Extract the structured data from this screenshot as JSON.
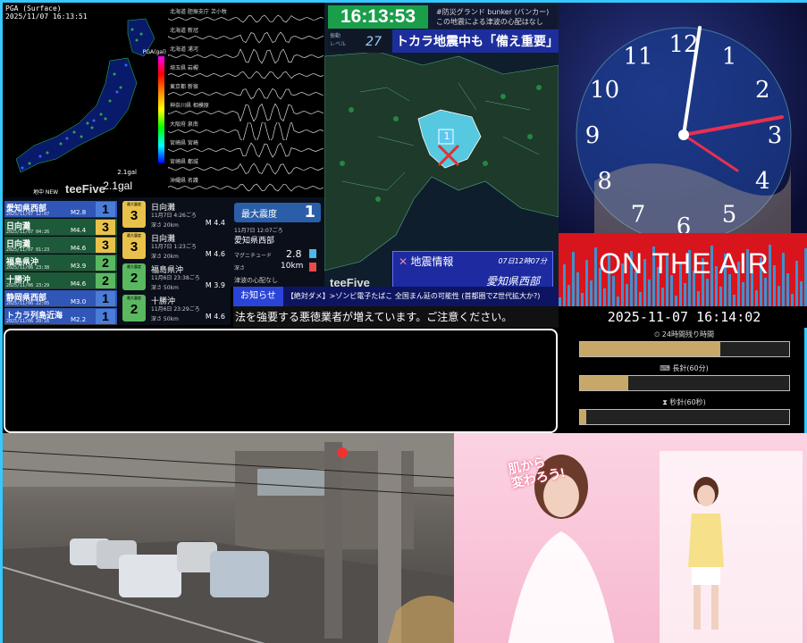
{
  "pga_panel": {
    "header_line1": "PGA (Surface)",
    "header_line2": "2025/11/07 16:13:51",
    "legend_title": "PGA(gal)",
    "gal_value": "2.1gal",
    "gal_small": "2.1gal",
    "footer_left": "地中 NEW",
    "logo": "teeFive"
  },
  "waveforms": {
    "stations": [
      "北海道 胆振支庁 苫小牧",
      "北海道 新冠",
      "北海道 浦河",
      "埼玉県 岩槻",
      "東京都 新宿",
      "神奈川県 相模原",
      "大阪府 泉南",
      "宮崎県 宮崎",
      "宮崎県 都城",
      "沖縄県 名護"
    ]
  },
  "eq_list": {
    "items": [
      {
        "name": "愛知県西部",
        "datetime": "2025/11/07 12:07",
        "mag": "M2.8",
        "shindo": "1",
        "color": "#4a7cd8"
      },
      {
        "name": "日向灘",
        "datetime": "2025/11/07 04:26",
        "mag": "M4.4",
        "shindo": "3",
        "color": "#e8c24a"
      },
      {
        "name": "日向灘",
        "datetime": "2025/11/07 01:23",
        "mag": "M4.6",
        "shindo": "3",
        "color": "#e8c24a"
      },
      {
        "name": "福島県沖",
        "datetime": "2025/11/06 23:38",
        "mag": "M3.9",
        "shindo": "2",
        "color": "#5ab860"
      },
      {
        "name": "十勝沖",
        "datetime": "2025/11/06 23:29",
        "mag": "M4.6",
        "shindo": "2",
        "color": "#5ab860"
      },
      {
        "name": "静岡県西部",
        "datetime": "2025/11/06 22:05",
        "mag": "M3.0",
        "shindo": "1",
        "color": "#4a7cd8"
      },
      {
        "name": "トカラ列島近海",
        "datetime": "2025/11/06 20:16",
        "mag": "M2.2",
        "shindo": "1",
        "color": "#4a7cd8"
      }
    ]
  },
  "eq_detail": {
    "badge_label": "最大震度",
    "items": [
      {
        "place": "日向灘",
        "time": "11月7日 4:26ごろ",
        "depth": "深さ 20km",
        "mag": "M 4.4",
        "shindo": "3",
        "color": "#e8c24a"
      },
      {
        "place": "日向灘",
        "time": "11月7日 1:23ごろ",
        "depth": "深さ 20km",
        "mag": "M 4.6",
        "shindo": "3",
        "color": "#e8c24a"
      },
      {
        "place": "福島県沖",
        "time": "11月6日 23:38ごろ",
        "depth": "深さ 50km",
        "mag": "M 3.9",
        "shindo": "2",
        "color": "#5ab860"
      },
      {
        "place": "十勝沖",
        "time": "11月6日 23:29ごろ",
        "depth": "深さ 50km",
        "mag": "M 4.6",
        "shindo": "2",
        "color": "#5ab860"
      }
    ]
  },
  "max_intensity": {
    "label": "最大震度",
    "value": "1",
    "datetime": "11月7日 12:07ごろ",
    "region": "愛知県西部",
    "mag_label": "マグニチュード",
    "mag_value": "2.8",
    "depth_label": "深さ",
    "depth_value": "10km",
    "tsunami": "津波の心配なし"
  },
  "map_panel": {
    "clock": "16:13:53",
    "ticker_line1": "#防災グランド bunker (バンカー)",
    "ticker_line2": "この地震による津波の心配はなし",
    "scale_label_1": "振動",
    "scale_label_2": "レベル",
    "scale_value": "27",
    "headline": "トカラ地震中も「備え重要」",
    "epicenter_shindo": "1",
    "info_title": "地震情報",
    "info_date": "07日12時07分",
    "info_region": "愛知県西部",
    "logo": "teeFive"
  },
  "notice": {
    "label": "お知らせ",
    "text": "【絶対ダメ】>ゾンビ電子たばこ 全国まん延の可能性 (首都圏でZ世代拡大か?)"
  },
  "scroll_text": "法を強要する悪徳業者が増えています。ご注意ください。",
  "clock_panel": {
    "numerals": [
      "12",
      "1",
      "2",
      "3",
      "4",
      "5",
      "6",
      "7",
      "8",
      "9",
      "10",
      "11"
    ],
    "onair_text": "ON THE AIR",
    "datetime": "2025-11-07 16:14:02",
    "bars": [
      {
        "label": "24時間残り時間",
        "fill": 0.67,
        "icon": "clock-icon"
      },
      {
        "label": "長針(60分)",
        "fill": 0.23,
        "icon": "calendar-icon"
      },
      {
        "label": "秒針(60秒)",
        "fill": 0.03,
        "icon": "hourglass-icon"
      }
    ]
  },
  "ad_panel": {
    "copy_line1": "肌から",
    "copy_line2": "変わろう!"
  }
}
